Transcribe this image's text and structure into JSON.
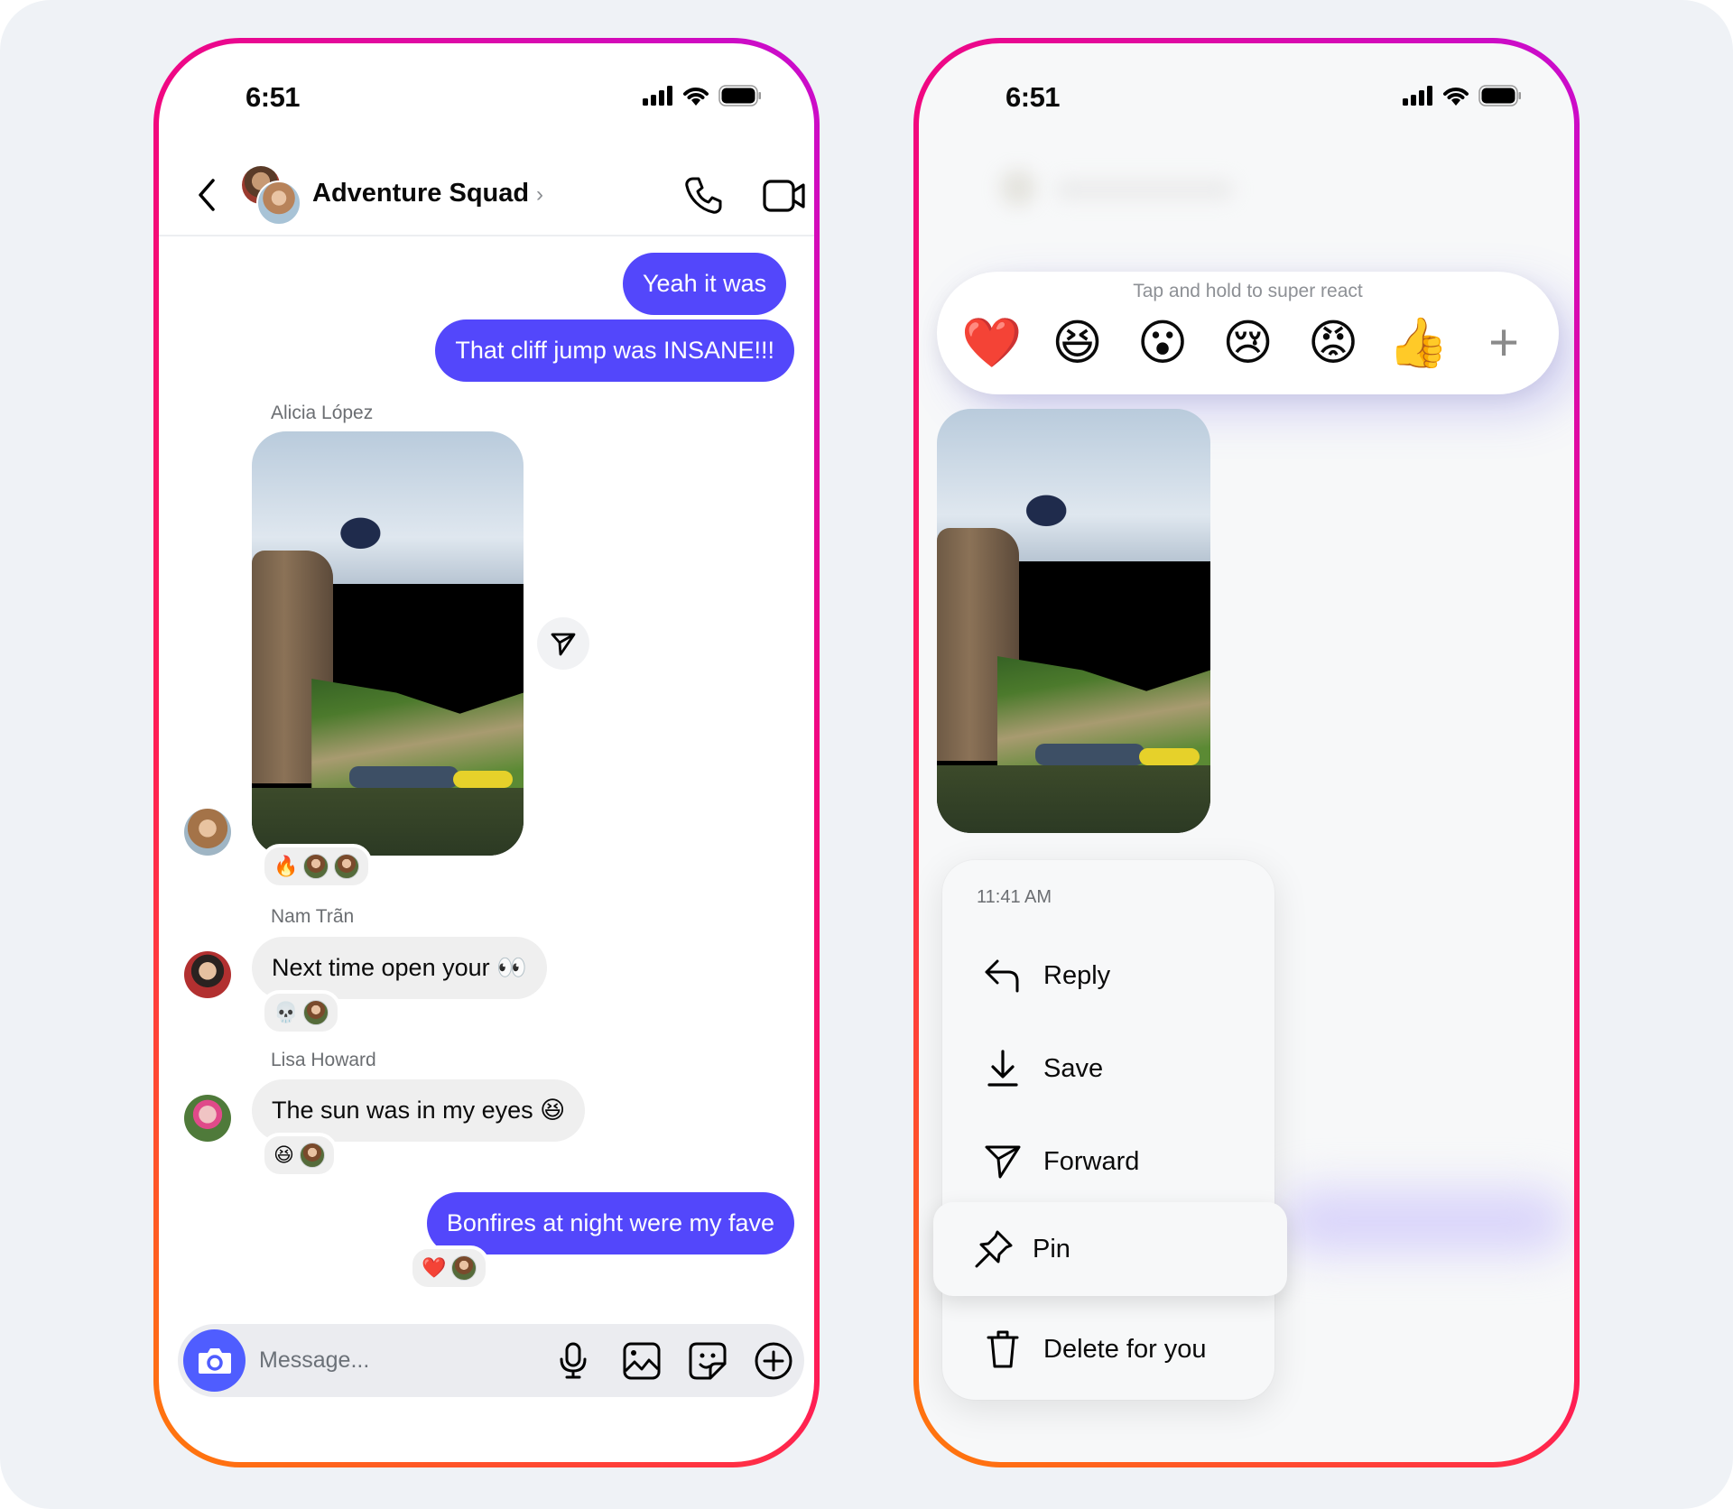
{
  "status_bar": {
    "time": "6:51"
  },
  "chat": {
    "title": "Adventure Squad",
    "header_icons": [
      "back-chevron-icon",
      "group-avatar",
      "chevron-right-icon",
      "phone-icon",
      "video-camera-icon"
    ],
    "messages": [
      {
        "direction": "outgoing",
        "text": "Yeah it was"
      },
      {
        "direction": "outgoing",
        "text": "That cliff jump was INSANE!!!"
      },
      {
        "direction": "incoming",
        "sender": "Alicia López",
        "type": "photo",
        "photo_description": "Person jumping off a cliff into a river with rafts",
        "reactions": [
          "🔥",
          "avatar",
          "avatar"
        ]
      },
      {
        "direction": "incoming",
        "sender": "Nam Trãn",
        "text": "Next time open your 👀",
        "reactions": [
          "💀",
          "avatar"
        ]
      },
      {
        "direction": "incoming",
        "sender": "Lisa Howard",
        "text": "The sun was in my eyes 😆",
        "reactions": [
          "😆",
          "avatar"
        ]
      },
      {
        "direction": "outgoing",
        "text": "Bonfires at night were my fave",
        "reactions": [
          "❤️",
          "avatar"
        ]
      }
    ],
    "composer": {
      "placeholder": "Message...",
      "icons": [
        "camera-icon",
        "microphone-icon",
        "gallery-icon",
        "sticker-icon",
        "add-icon"
      ]
    }
  },
  "context": {
    "reaction_hint": "Tap and hold to super react",
    "reactions": [
      "❤️",
      "😆",
      "😮",
      "😢",
      "😡",
      "👍"
    ],
    "more_label": "+",
    "menu": {
      "timestamp": "11:41 AM",
      "items": [
        {
          "label": "Reply",
          "icon": "reply-icon"
        },
        {
          "label": "Save",
          "icon": "download-icon"
        },
        {
          "label": "Forward",
          "icon": "send-icon"
        },
        {
          "label": "Pin",
          "icon": "pin-icon",
          "highlighted": true
        },
        {
          "label": "Delete for you",
          "icon": "trash-icon"
        }
      ]
    }
  },
  "colors": {
    "accent": "#5347fb",
    "camera_button": "#4f5dff",
    "incoming_bubble": "#efefef",
    "border_gradient": [
      "#c80ccf",
      "#f2077f",
      "#ff1d54",
      "#ff7a0a"
    ]
  }
}
